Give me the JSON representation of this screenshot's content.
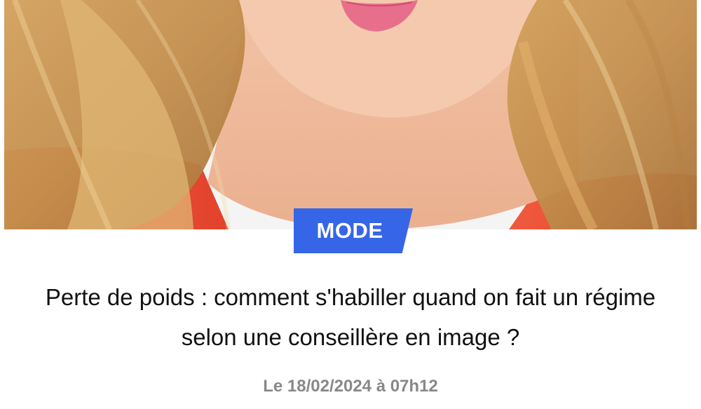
{
  "article": {
    "category": "MODE",
    "title": "Perte de poids : comment s'habiller quand on fait un régime selon une conseillère en image ?",
    "date": "Le 18/02/2024 à 07h12"
  },
  "colors": {
    "badge": "#3666e7",
    "title": "#111111",
    "date": "#888888"
  }
}
